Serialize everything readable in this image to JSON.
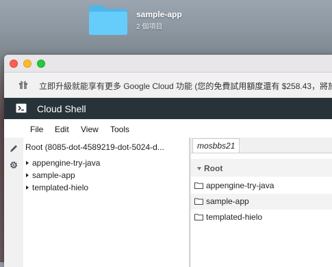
{
  "desktop": {
    "folder_name": "sample-app",
    "folder_sub": "2 個項目"
  },
  "promo": {
    "text": "立即升級就能享有更多 Google Cloud 功能 (您的免費試用額度還有 $258.43，將於"
  },
  "shell": {
    "title": "Cloud Shell"
  },
  "menu": [
    "File",
    "Edit",
    "View",
    "Tools"
  ],
  "tree": {
    "root": "Root (8085-dot-4589219-dot-5024-d...",
    "items": [
      "appengine-try-java",
      "sample-app",
      "templated-hielo"
    ]
  },
  "editor": {
    "tab": "mosbbs21",
    "root_label": "Root",
    "rows": [
      "appengine-try-java",
      "sample-app",
      "templated-hielo"
    ]
  },
  "colors": {
    "shellbar": "#283339",
    "folder": "#5fc6f8"
  }
}
